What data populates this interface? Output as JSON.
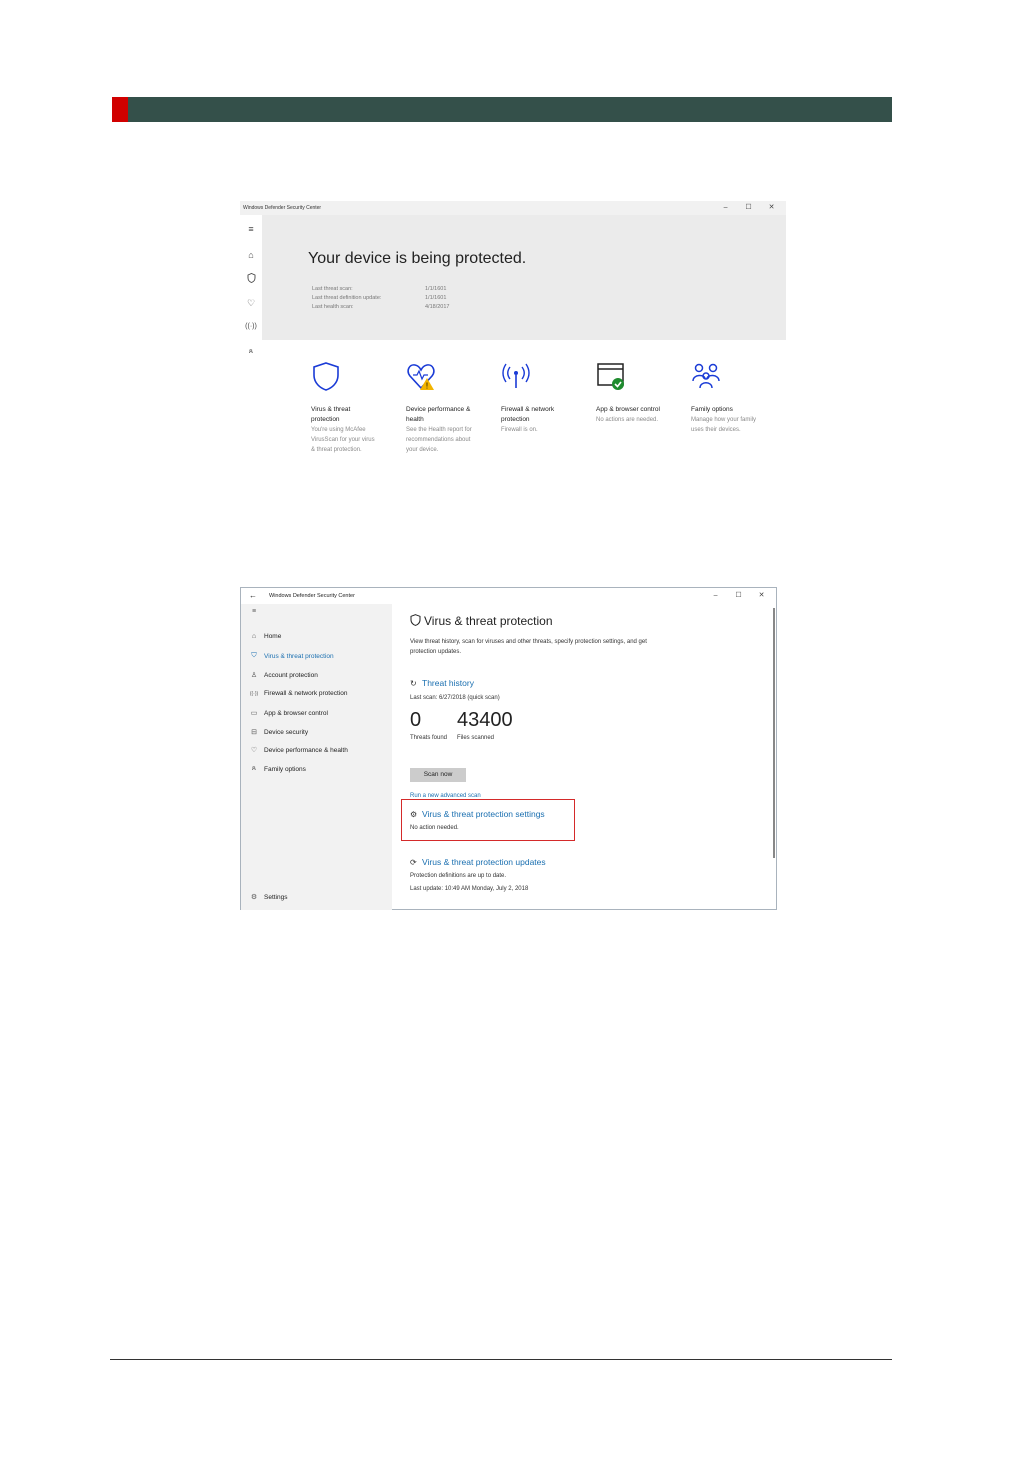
{
  "shot1": {
    "window_title": "Windows Defender Security Center",
    "window_controls": [
      "–",
      "☐",
      "✕"
    ],
    "headline": "Your device is being protected.",
    "stats": [
      {
        "label": "Last threat scan:",
        "value": "1/1/1601"
      },
      {
        "label": "Last threat definition update:",
        "value": "1/1/1601"
      },
      {
        "label": "Last health scan:",
        "value": "4/18/2017"
      }
    ],
    "tiles": [
      {
        "title": "Virus & threat protection",
        "desc": "You're using McAfee VirusScan for your virus & threat protection."
      },
      {
        "title": "Device performance & health",
        "desc": "See the Health report for recommendations about your device."
      },
      {
        "title": "Firewall & network protection",
        "desc": "Firewall is on."
      },
      {
        "title": "App & browser control",
        "desc": "No actions are needed."
      },
      {
        "title": "Family options",
        "desc": "Manage how your family uses their devices."
      }
    ],
    "accent": "#1a3bd6"
  },
  "shot2": {
    "window_title": "Windows Defender Security Center",
    "window_controls": [
      "–",
      "☐",
      "✕"
    ],
    "nav": [
      {
        "label": "Home",
        "icon": "home-icon"
      },
      {
        "label": "Virus & threat protection",
        "icon": "shield-icon"
      },
      {
        "label": "Account protection",
        "icon": "person-icon"
      },
      {
        "label": "Firewall & network protection",
        "icon": "antenna-icon"
      },
      {
        "label": "App & browser control",
        "icon": "window-icon"
      },
      {
        "label": "Device security",
        "icon": "laptop-icon"
      },
      {
        "label": "Device performance & health",
        "icon": "heart-icon"
      },
      {
        "label": "Family options",
        "icon": "family-icon"
      }
    ],
    "settings_label": "Settings",
    "heading": "Virus & threat protection",
    "description": "View threat history, scan for viruses and other threats, specify protection settings, and get protection updates.",
    "threat_history": {
      "title": "Threat history",
      "last_scan": "Last scan: 6/27/2018 (quick scan)",
      "threats_found": "0",
      "threats_found_label": "Threats found",
      "files_scanned": "43400",
      "files_scanned_label": "Files scanned",
      "scan_button": "Scan now",
      "advanced_link": "Run a new advanced scan"
    },
    "settings_section": {
      "title": "Virus & threat protection settings",
      "status": "No action needed."
    },
    "updates_section": {
      "title": "Virus & threat protection updates",
      "status": "Protection definitions are up to date.",
      "last_update": "Last update: 10:49 AM Monday, July 2, 2018"
    },
    "accent": "#1a6fb0",
    "highlight": "#d42a2a"
  }
}
